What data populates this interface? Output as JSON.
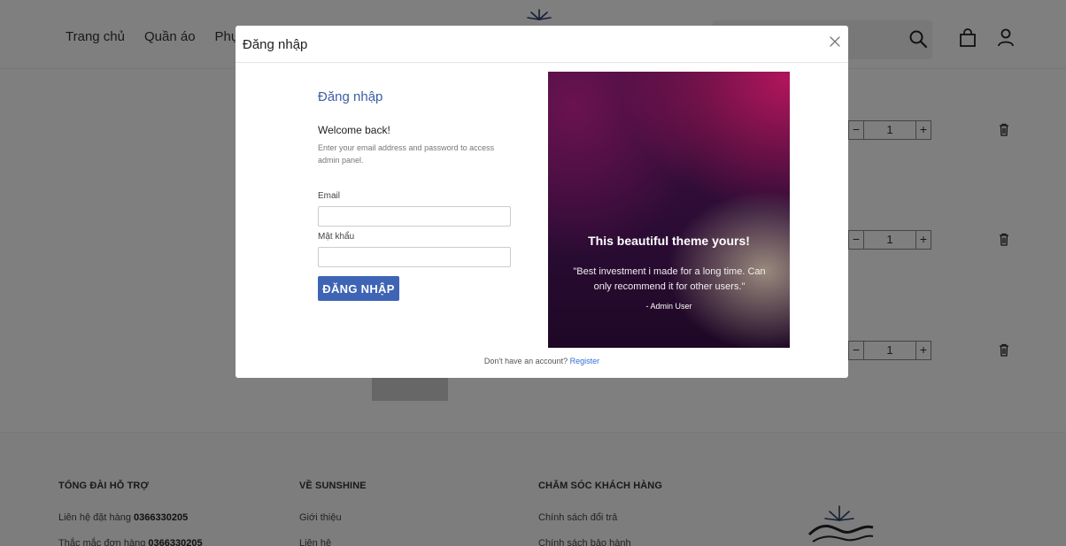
{
  "header": {
    "nav": [
      "Trang chủ",
      "Quần áo",
      "Phụ"
    ]
  },
  "cart": {
    "rows": [
      {
        "minus": "−",
        "qty": "1",
        "plus": "+"
      },
      {
        "minus": "−",
        "qty": "1",
        "plus": "+"
      },
      {
        "minus": "−",
        "qty": "1",
        "plus": "+"
      }
    ]
  },
  "footer": {
    "support": {
      "heading": "TỔNG ĐÀI HỖ TRỢ",
      "line1_text": "Liên hệ đặt hàng ",
      "line1_phone": "0366330205",
      "line2_text": "Thắc mắc đơn hàng ",
      "line2_phone": "0366330205"
    },
    "about": {
      "heading": "VỀ SUNSHINE",
      "links": [
        "Giới thiệu",
        "Liên hệ"
      ]
    },
    "care": {
      "heading": "CHĂM SÓC KHÁCH HÀNG",
      "links": [
        "Chính sách đổi trả",
        "Chính sách bảo hành"
      ]
    }
  },
  "modal": {
    "title": "Đăng nhập",
    "close_glyph": "×",
    "form": {
      "title": "Đăng nhập",
      "welcome": "Welcome back!",
      "description": "Enter your email address and password to access admin panel.",
      "email_label": "Email",
      "email_value": "",
      "password_label": "Mật khẩu",
      "password_value": "",
      "submit_label": "ĐĂNG NHẬP"
    },
    "promo": {
      "title": "This beautiful theme yours!",
      "quote": "\"Best investment i made for a long time. Can only recommend it for other users.\"",
      "author": "- Admin User"
    },
    "register": {
      "text": "Don't have an account? ",
      "link": "Register"
    }
  },
  "colors": {
    "accent": "#3e64b5",
    "link": "#2f6fd6",
    "title_blue": "#3a5fa5"
  },
  "icons": [
    "search-icon",
    "bag-icon",
    "user-icon",
    "trash-icon",
    "close-icon",
    "sunshine-logo-icon"
  ]
}
